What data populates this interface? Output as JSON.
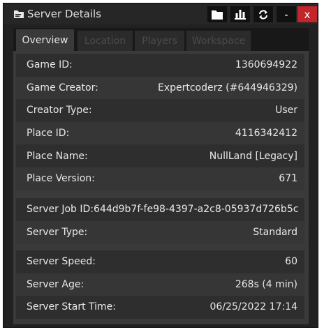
{
  "window": {
    "title": "Server Details",
    "buttons": {
      "folder_icon": "folder-icon",
      "stats_icon": "bar-chart-icon",
      "refresh_icon": "refresh-icon",
      "minimize_label": "-",
      "close_label": "x"
    },
    "close_color": "#c0262b"
  },
  "tabs": [
    {
      "label": "Overview",
      "active": true
    },
    {
      "label": "Location",
      "active": false
    },
    {
      "label": "Players",
      "active": false
    },
    {
      "label": "Workspace",
      "active": false
    }
  ],
  "groups": [
    {
      "rows": [
        {
          "label": "Game ID:",
          "value": "1360694922"
        },
        {
          "label": "Game Creator:",
          "value": "Expertcoderz (#644946329)"
        },
        {
          "label": "Creator Type:",
          "value": "User"
        },
        {
          "label": "Place ID:",
          "value": "4116342412"
        },
        {
          "label": "Place Name:",
          "value": "NullLand [Legacy]"
        },
        {
          "label": "Place Version:",
          "value": "671"
        }
      ]
    },
    {
      "rows": [
        {
          "label": "Server Job ID:",
          "value": "644d9b7f-fe98-4397-a2c8-05937d726b5c"
        },
        {
          "label": "Server Type:",
          "value": "Standard"
        }
      ]
    },
    {
      "rows": [
        {
          "label": "Server Speed:",
          "value": "60"
        },
        {
          "label": "Server Age:",
          "value": "268s (4 min)"
        },
        {
          "label": "Server Start Time:",
          "value": "06/25/2022 17:14"
        }
      ]
    }
  ]
}
